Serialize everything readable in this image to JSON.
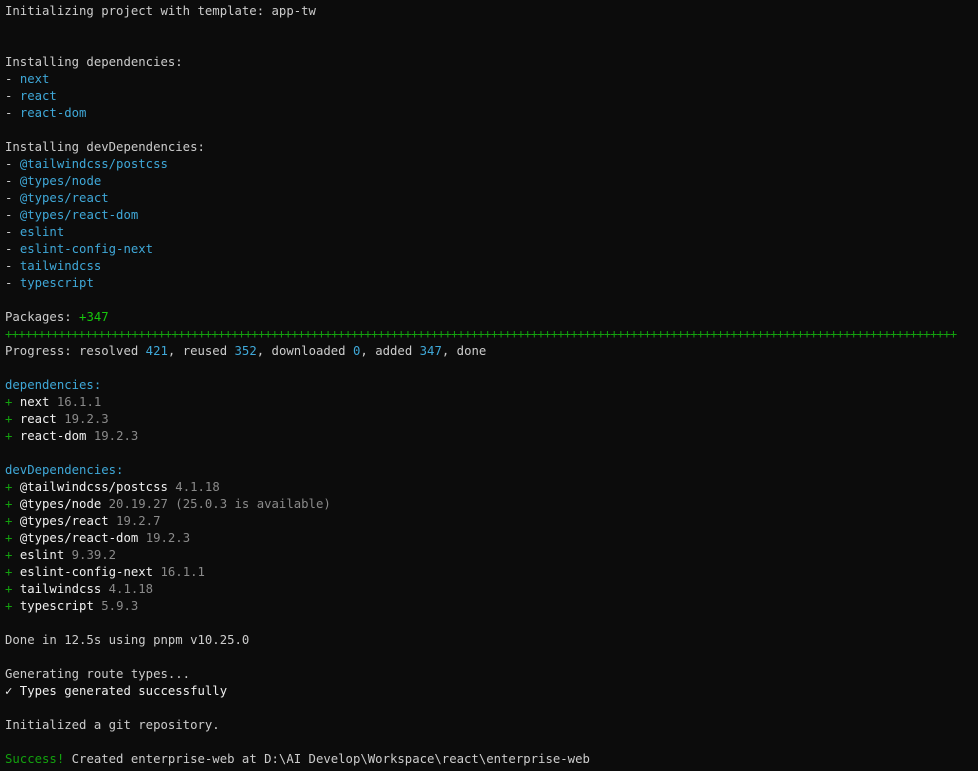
{
  "terminal": {
    "init_line": "Initializing project with template: app-tw",
    "installing_deps": {
      "heading": "Installing dependencies:",
      "items": [
        "next",
        "react",
        "react-dom"
      ]
    },
    "installing_dev_deps": {
      "heading": "Installing devDependencies:",
      "items": [
        "@tailwindcss/postcss",
        "@types/node",
        "@types/react",
        "@types/react-dom",
        "eslint",
        "eslint-config-next",
        "tailwindcss",
        "typescript"
      ]
    },
    "packages": {
      "label": "Packages: ",
      "value": "+347"
    },
    "progress": {
      "prefix": "Progress: resolved ",
      "resolved": "421",
      "reused_label": ", reused ",
      "reused": "352",
      "downloaded_label": ", downloaded ",
      "downloaded": "0",
      "added_label": ", added ",
      "added": "347",
      "suffix": ", done",
      "bar": "+++++++++++++++++++++++++++++++++++++++++++++++++++++++++++++++++++++++++++++++++++++++++++++++++++++++++++++++++++++++++++++++++++++++++++++++"
    },
    "deps": {
      "heading": "dependencies:",
      "items": [
        {
          "name": "next",
          "version": "16.1.1"
        },
        {
          "name": "react",
          "version": "19.2.3"
        },
        {
          "name": "react-dom",
          "version": "19.2.3"
        }
      ]
    },
    "dev_deps": {
      "heading": "devDependencies:",
      "items": [
        {
          "name": "@tailwindcss/postcss",
          "version": "4.1.18"
        },
        {
          "name": "@types/node",
          "version": "20.19.27 (25.0.3 is available)"
        },
        {
          "name": "@types/react",
          "version": "19.2.7"
        },
        {
          "name": "@types/react-dom",
          "version": "19.2.3"
        },
        {
          "name": "eslint",
          "version": "9.39.2"
        },
        {
          "name": "eslint-config-next",
          "version": "16.1.1"
        },
        {
          "name": "tailwindcss",
          "version": "4.1.18"
        },
        {
          "name": "typescript",
          "version": "5.9.3"
        }
      ]
    },
    "done_line": "Done in 12.5s using pnpm v10.25.0",
    "route_types": "Generating route types...",
    "types_generated": "✓ Types generated successfully",
    "git_init": "Initialized a git repository.",
    "success": {
      "label": "Success!",
      "message": " Created enterprise-web at D:\\AI Develop\\Workspace\\react\\enterprise-web"
    },
    "colors": {
      "background": "#0c0c0c",
      "text": "#cccccc",
      "cyan": "#3a96dd",
      "green": "#16c60c"
    }
  }
}
